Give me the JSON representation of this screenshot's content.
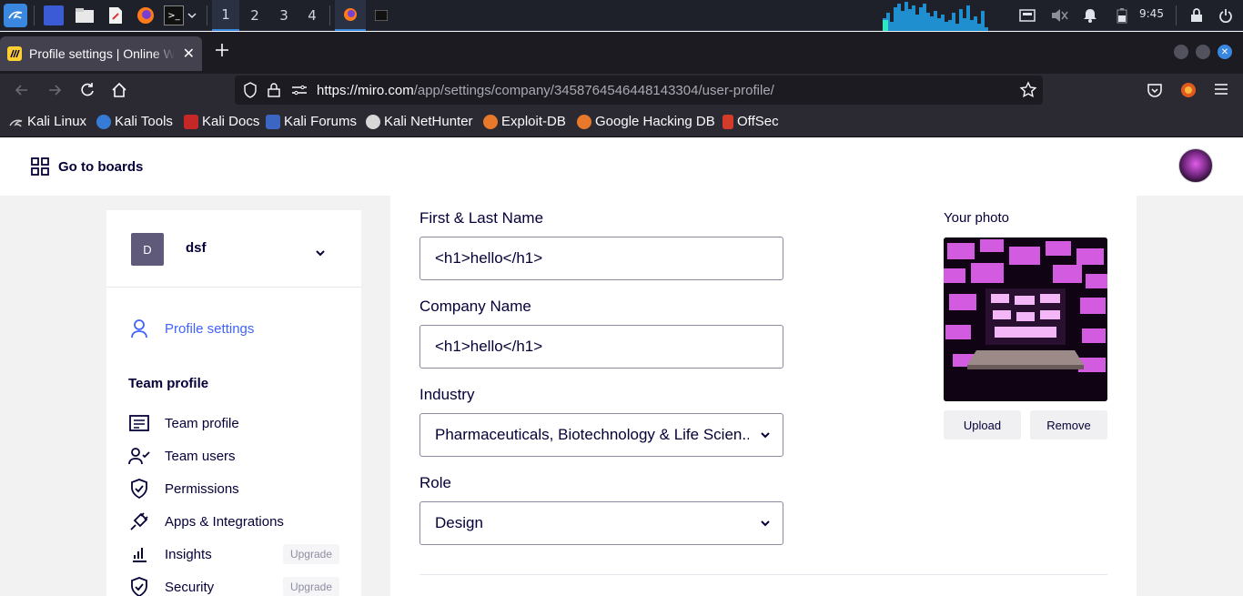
{
  "taskbar": {
    "workspaces": [
      "1",
      "2",
      "3",
      "4"
    ],
    "clock": "9:45"
  },
  "browser": {
    "tab_title": "Profile settings | Online W",
    "url_host": "https://miro.com",
    "url_path": "/app/settings/company/3458764546448143304/user-profile/",
    "bookmarks": [
      "Kali Linux",
      "Kali Tools",
      "Kali Docs",
      "Kali Forums",
      "Kali NetHunter",
      "Exploit-DB",
      "Google Hacking DB",
      "OffSec"
    ]
  },
  "header": {
    "go_to_boards": "Go to boards"
  },
  "sidebar": {
    "team_initial": "D",
    "team_name": "dsf",
    "profile_settings": "Profile settings",
    "section_title": "Team profile",
    "items": [
      {
        "label": "Team profile",
        "icon": "id-card-icon"
      },
      {
        "label": "Team users",
        "icon": "user-check-icon"
      },
      {
        "label": "Permissions",
        "icon": "shield-check-icon"
      },
      {
        "label": "Apps & Integrations",
        "icon": "plug-icon"
      },
      {
        "label": "Insights",
        "icon": "bar-chart-icon",
        "badge": "Upgrade"
      },
      {
        "label": "Security",
        "icon": "shield-check-icon",
        "badge": "Upgrade"
      }
    ]
  },
  "form": {
    "name_label": "First & Last Name",
    "name_value": "<h1>hello</h1>",
    "company_label": "Company Name",
    "company_value": "<h1>hello</h1>",
    "industry_label": "Industry",
    "industry_value": "Pharmaceuticals, Biotechnology & Life Scien...",
    "role_label": "Role",
    "role_value": "Design"
  },
  "photo": {
    "title": "Your photo",
    "upload": "Upload",
    "remove": "Remove"
  },
  "colors": {
    "accent": "#4262ff",
    "text": "#050038",
    "team_avatar": "#5f5a7a"
  }
}
